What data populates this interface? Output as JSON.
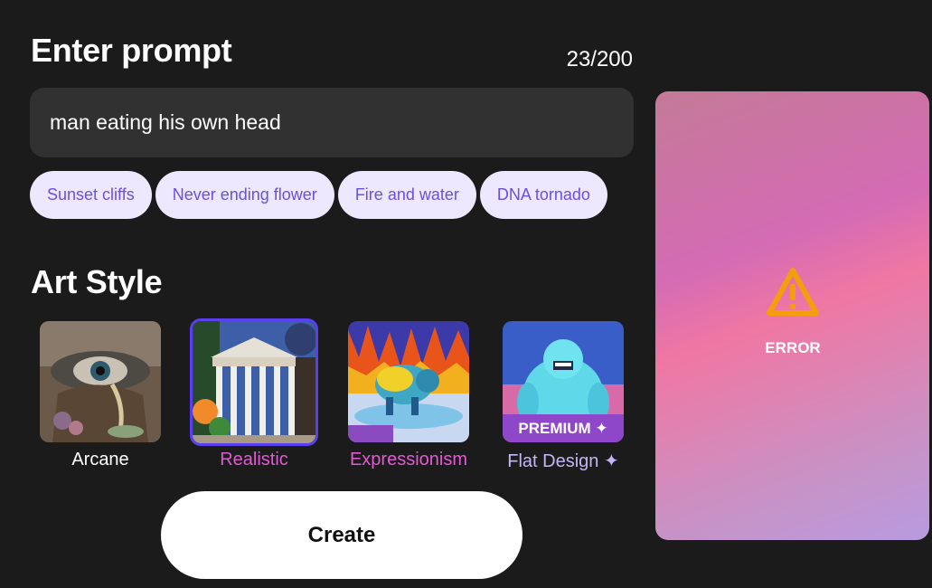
{
  "prompt": {
    "title": "Enter prompt",
    "char_count": "23/200",
    "input_value": "man eating his own head"
  },
  "suggestions": [
    "Sunset cliffs",
    "Never ending flower",
    "Fire and water",
    "DNA tornado"
  ],
  "art_style": {
    "title": "Art Style",
    "styles": [
      {
        "label": "Arcane",
        "selected": false,
        "premium": false
      },
      {
        "label": "Realistic",
        "selected": true,
        "premium": false
      },
      {
        "label": "Expressionism",
        "selected": false,
        "premium": false
      },
      {
        "label": "Flat Design ✦",
        "selected": false,
        "premium": true,
        "badge": "PREMIUM ✦"
      }
    ]
  },
  "create_label": "Create",
  "preview": {
    "status_text": "ERROR",
    "icon": "warning-icon"
  },
  "colors": {
    "background": "#1b1b1b",
    "chip_bg": "#ede8fd",
    "chip_text": "#6a4fe0",
    "selected_border": "#5a3ff0",
    "selected_label": "#e25ad4",
    "premium_label": "#c8b4f6",
    "warning": "#f59e0b"
  }
}
